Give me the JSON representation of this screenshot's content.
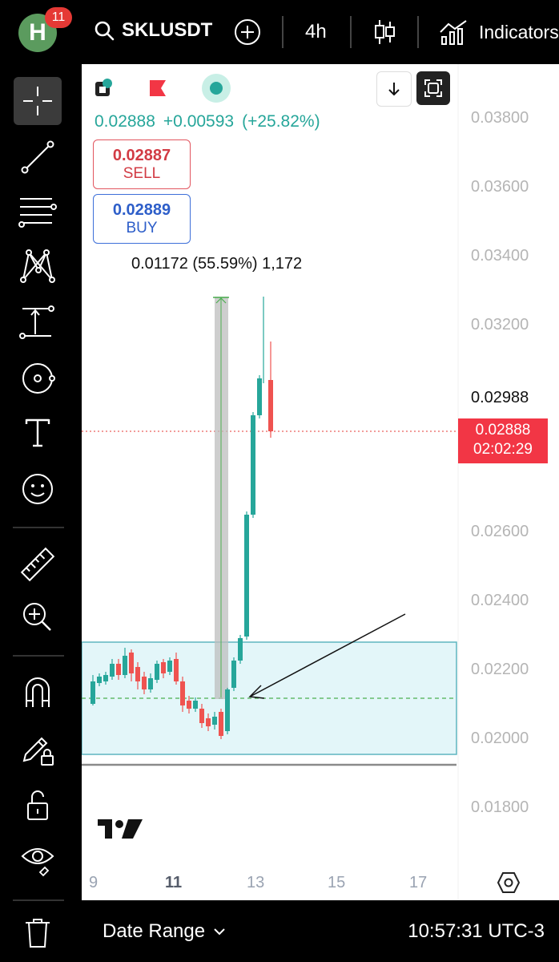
{
  "topbar": {
    "avatar_letter": "H",
    "notification_count": "11",
    "symbol": "SKLUSDT",
    "interval": "4h",
    "indicators_label": "Indicators"
  },
  "chart": {
    "price": "0.02888",
    "change": "+0.00593",
    "change_pct": "(+25.82%)",
    "sell_price": "0.02887",
    "sell_label": "SELL",
    "buy_price": "0.02889",
    "buy_label": "BUY",
    "measure_text": "0.01172 (55.59%) 1,172",
    "price_axis": [
      "0.03800",
      "0.03600",
      "0.03400",
      "0.03200",
      "0.02600",
      "0.02400",
      "0.02200",
      "0.02000",
      "0.01800"
    ],
    "high_label": "0.02988",
    "current_price_label": "0.02888",
    "countdown": "02:02:29",
    "x_labels": [
      "9",
      "11",
      "13",
      "15",
      "17"
    ]
  },
  "bottombar": {
    "date_range_label": "Date Range",
    "clock": "10:57:31 UTC-3"
  },
  "colors": {
    "up": "#26a69a",
    "down": "#ef5350",
    "zone_fill": "#e3f6f9",
    "zone_border": "#5fb5bf"
  }
}
